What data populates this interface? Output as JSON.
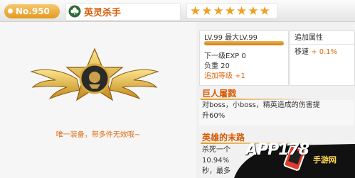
{
  "header": {
    "number": "No.950",
    "hero_name": "英灵杀手",
    "stars": [
      "★",
      "★",
      "★",
      "★",
      "★",
      "★",
      "★"
    ]
  },
  "equipment": {
    "caption": "唯一装备，带多件无效哦~"
  },
  "level": {
    "text": "LV.99 最大LV.99",
    "progress": 1.0,
    "next_exp": "下一级EXP 0",
    "load": "负重 20",
    "bonus": "追加等级 +1"
  },
  "attribute": {
    "title": "追加属性",
    "name": "移速",
    "value": "+ 0.1%"
  },
  "skills": [
    {
      "title": "巨人屠戮",
      "desc_1": "对boss，小boss，精英造成的伤害提",
      "desc_2": "升60%"
    },
    {
      "title": "英雄的末路",
      "desc_1": "杀死一个",
      "desc_2": "10.94%",
      "desc_3": "秒，最多"
    }
  ],
  "watermark": {
    "brand": "APP178",
    "sub": "手游网"
  },
  "colors": {
    "accent": "#e06b10",
    "star": "#f0a020",
    "badge": "#e39a1f"
  }
}
